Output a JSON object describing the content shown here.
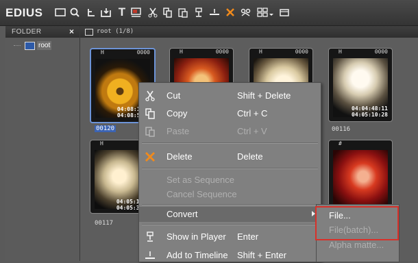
{
  "app": {
    "logo": "EDIUS"
  },
  "toolbar": {
    "icons": [
      "new-bin-icon",
      "search-icon",
      "up-folder-icon",
      "add-to-folder-icon",
      "title-icon",
      "quick-title-icon",
      "cut-icon",
      "copy-icon",
      "paste-icon",
      "show-in-player-icon",
      "add-to-timeline-icon",
      "delete-icon",
      "properties-icon",
      "view-icon",
      "dropdown-icon",
      "bin-icon"
    ]
  },
  "folder_panel": {
    "title": "FOLDER",
    "close": "×",
    "tree": [
      {
        "label": "root"
      }
    ]
  },
  "bin": {
    "path": "root (1/8)"
  },
  "clips": [
    {
      "type_icon": "H",
      "number": "0000",
      "tc_in": "04:08:17:1",
      "tc_out": "04:08:58:1",
      "label": "00120",
      "selected": true
    },
    {
      "type_icon": "H",
      "number": "0000",
      "tc_in": "",
      "tc_out": "",
      "label": ""
    },
    {
      "type_icon": "H",
      "number": "0000",
      "tc_in": "",
      "tc_out": "",
      "label": ""
    },
    {
      "type_icon": "H",
      "number": "0000",
      "tc_in": "04:04:48:11",
      "tc_out": "04:05:10:28",
      "label": "00116"
    },
    {
      "type_icon": "H",
      "number": "",
      "tc_in": "04:05:10:2",
      "tc_out": "04:05:30:1",
      "label": "00117"
    },
    {
      "type_icon": "#",
      "number": "",
      "tc_in": "",
      "tc_out": "",
      "label": ""
    }
  ],
  "context_menu": {
    "cut": {
      "label": "Cut",
      "shortcut": "Shift + Delete"
    },
    "copy": {
      "label": "Copy",
      "shortcut": "Ctrl + C"
    },
    "paste": {
      "label": "Paste",
      "shortcut": "Ctrl + V"
    },
    "delete": {
      "label": "Delete",
      "shortcut": "Delete"
    },
    "set_as_sequence": {
      "label": "Set as Sequence"
    },
    "cancel_sequence": {
      "label": "Cancel Sequence"
    },
    "convert": {
      "label": "Convert"
    },
    "show_in_player": {
      "label": "Show in Player",
      "shortcut": "Enter"
    },
    "add_to_timeline": {
      "label": "Add to Timeline",
      "shortcut": "Shift + Enter"
    }
  },
  "convert_submenu": {
    "file": "File...",
    "file_batch": "File(batch)...",
    "alpha_matte": "Alpha matte..."
  },
  "colors": {
    "accent": "#6d94d8",
    "highlight_box": "#d8312a",
    "menu_bg": "#808080"
  }
}
